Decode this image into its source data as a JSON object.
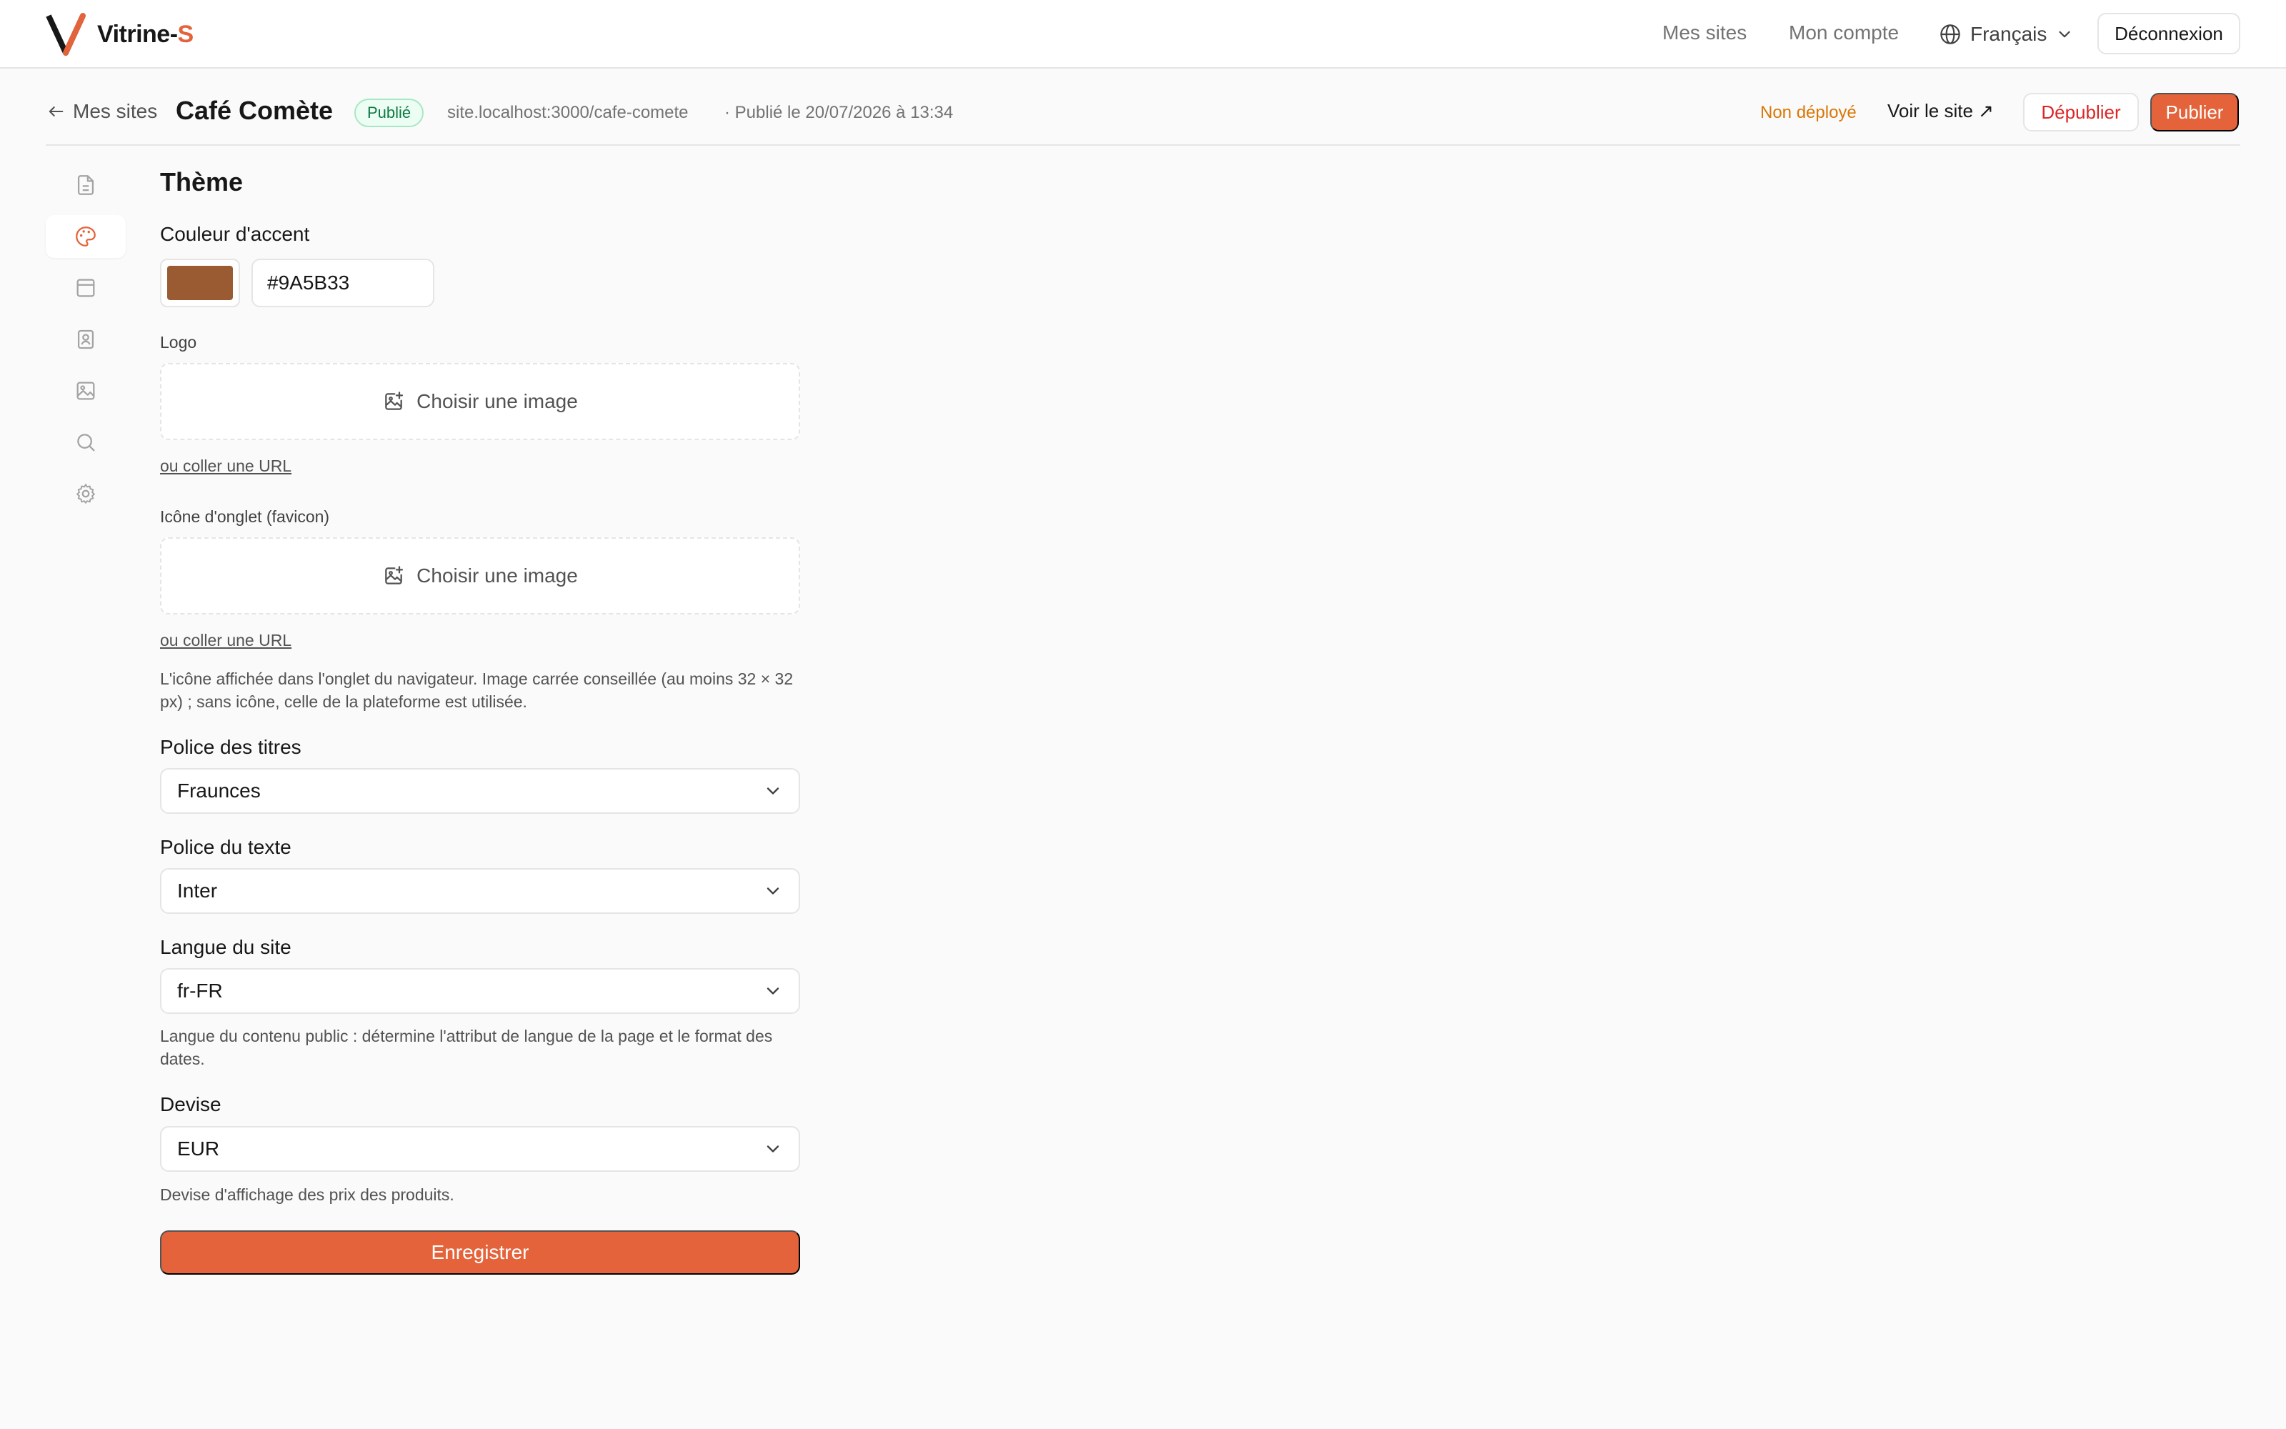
{
  "brand": {
    "name_part1": "Vitrine-",
    "name_part2": "S",
    "accent": "#e4633a"
  },
  "nav": {
    "my_sites": "Mes sites",
    "my_account": "Mon compte",
    "language": "Français",
    "logout": "Déconnexion"
  },
  "site": {
    "back_label": "Mes sites",
    "title": "Café Comète",
    "status_badge": "Publié",
    "url": "site.localhost:3000/cafe-comete",
    "published_at": "· Publié le 20/07/2026 à 13:34",
    "deploy_status": "Non déployé",
    "view_site": "Voir le site ↗",
    "unpublish": "Dépublier",
    "publish": "Publier"
  },
  "rail": {
    "items": [
      {
        "icon": "file-text-icon"
      },
      {
        "icon": "palette-icon",
        "active": true
      },
      {
        "icon": "layout-icon"
      },
      {
        "icon": "contact-card-icon"
      },
      {
        "icon": "image-icon"
      },
      {
        "icon": "search-icon"
      },
      {
        "icon": "gear-icon"
      }
    ]
  },
  "theme": {
    "title": "Thème",
    "accent_label": "Couleur d'accent",
    "accent_value": "#9A5B33",
    "logo_label": "Logo",
    "choose_image": "Choisir une image",
    "paste_url": "ou coller une URL",
    "favicon_label": "Icône d'onglet (favicon)",
    "favicon_help": "L'icône affichée dans l'onglet du navigateur. Image carrée conseillée (au moins 32 × 32 px) ; sans icône, celle de la plateforme est utilisée.",
    "heading_font_label": "Police des titres",
    "heading_font_value": "Fraunces",
    "body_font_label": "Police du texte",
    "body_font_value": "Inter",
    "site_language_label": "Langue du site",
    "site_language_value": "fr-FR",
    "site_language_help": "Langue du contenu public : détermine l'attribut de langue de la page et le format des dates.",
    "currency_label": "Devise",
    "currency_value": "EUR",
    "currency_help": "Devise d'affichage des prix des produits.",
    "save": "Enregistrer"
  }
}
